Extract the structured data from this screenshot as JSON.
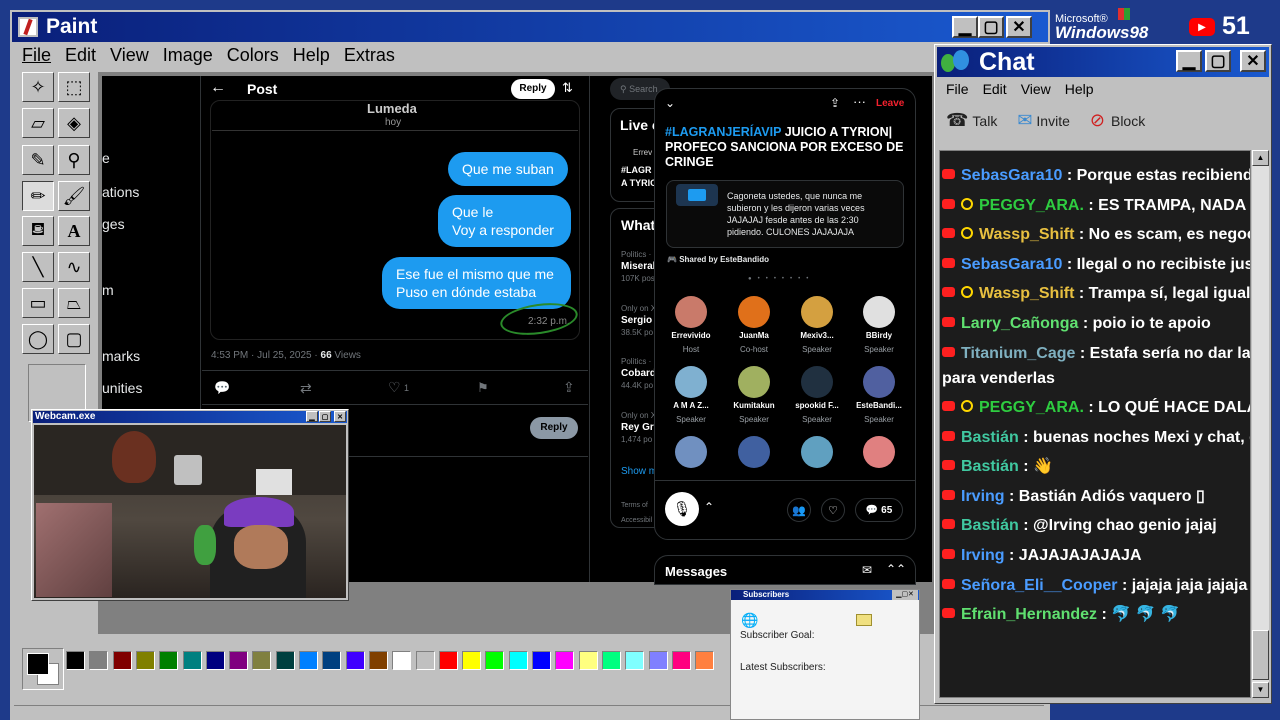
{
  "paint": {
    "title": "Paint",
    "menu": [
      "File",
      "Edit",
      "View",
      "Image",
      "Colors",
      "Help",
      "Extras"
    ],
    "palette": [
      "#000000",
      "#808080",
      "#800000",
      "#808000",
      "#008000",
      "#008080",
      "#000080",
      "#800080",
      "#808040",
      "#004040",
      "#0080ff",
      "#004080",
      "#4000ff",
      "#804000",
      "#ffffff",
      "#c0c0c0",
      "#ff0000",
      "#ffff00",
      "#00ff00",
      "#00ffff",
      "#0000ff",
      "#ff00ff",
      "#ffff80",
      "#00ff80",
      "#80ffff",
      "#8080ff",
      "#ff0080",
      "#ff8040"
    ]
  },
  "win98_logo": {
    "brand": "Microsoft®",
    "product": "Windows98"
  },
  "subs_count": "51",
  "twitter": {
    "header": "Post",
    "reply_button": "Reply",
    "top_name": "Lumeda",
    "top_sub": "hoy",
    "bubbles": [
      "Que me suban",
      "Que le\nVoy a responder",
      "Ese fue el mismo que me\nPuso en dónde estaba"
    ],
    "bubble_time": "2:32 p.m.",
    "meta_time": "4:53 PM · Jul 25, 2025 · ",
    "meta_views": "66",
    "meta_views_label": " Views",
    "likes": "1",
    "reply_box_button": "Reply",
    "left_nav": [
      "e",
      "ations",
      "ges",
      "m",
      "marks",
      "unities"
    ],
    "search_placeholder": "Search",
    "live_title": "Live o",
    "live_user": "Errev",
    "live_text1": "#LAGR",
    "live_text2": "A TYRIO",
    "whats": "What",
    "trends": [
      {
        "cat": "Politics · ",
        "title": "Miseral",
        "count": "107K posts"
      },
      {
        "cat": "Only on X",
        "title": "Sergio",
        "count": "38.5K po"
      },
      {
        "cat": "Politics ·",
        "title": "Cobard",
        "count": "44.4K po"
      },
      {
        "cat": "Only on X",
        "title": "Rey Gru",
        "count": "1,474 po"
      }
    ],
    "show_more": "Show m",
    "terms": "Terms of",
    "access": "Accessibil"
  },
  "space": {
    "leave": "Leave",
    "title_hashtag": "#LAGRANJERÍAVIP",
    "title_rest": " JUICIO A TYRION| PROFECO SANCIONA POR EXCESO DE CRINGE",
    "card_text": "Cagoneta ustedes, que nunca me subieron y les dijeron varias veces JAJAJAJ fesde antes de las 2:30 pidiendo. CULONES JAJAJAJA",
    "shared_by": "Shared by EsteBandido",
    "speakers": [
      {
        "name": "Errevivido",
        "role": "Host",
        "color": "#c97a6a"
      },
      {
        "name": "JuanMa",
        "role": "Co-host",
        "color": "#e0701a"
      },
      {
        "name": "Mexiv3...",
        "role": "Speaker",
        "color": "#d4a040"
      },
      {
        "name": "BBirdy",
        "role": "Speaker",
        "color": "#e0e0e0"
      },
      {
        "name": "A M A Z...",
        "role": "Speaker",
        "color": "#7fb0d0"
      },
      {
        "name": "Kumitakun",
        "role": "Speaker",
        "color": "#a0b060"
      },
      {
        "name": "spookid F...",
        "role": "Speaker",
        "color": "#203040"
      },
      {
        "name": "EsteBandi...",
        "role": "Speaker",
        "color": "#5060a0"
      },
      {
        "name": "",
        "role": "",
        "color": "#7090c0"
      },
      {
        "name": "",
        "role": "",
        "color": "#4060a0"
      },
      {
        "name": "",
        "role": "",
        "color": "#60a0c0"
      },
      {
        "name": "",
        "role": "",
        "color": "#e08080"
      }
    ],
    "reply_count": "65",
    "messages": "Messages"
  },
  "webcam": {
    "title": "Webcam.exe"
  },
  "subscribers": {
    "title": "Subscribers",
    "goal": "Subscriber Goal:",
    "latest": "Latest Subscribers:"
  },
  "chat": {
    "title": "Chat",
    "menu": [
      "File",
      "Edit",
      "View",
      "Help"
    ],
    "toolbar": [
      "Talk",
      "Invite",
      "Block"
    ],
    "messages": [
      {
        "user": "SebasGara10",
        "text": "Porque estas recibiendo lo q",
        "color": "#4a9cff",
        "mod": false
      },
      {
        "user": "PEGGY_ARA.",
        "text": "ES TRAMPA, NADA MÁS",
        "color": "#2ecc40",
        "mod": true
      },
      {
        "user": "Wassp_Shift",
        "text": "No es scam, es negocio",
        "color": "#e8c040",
        "mod": true
      },
      {
        "user": "SebasGara10",
        "text": "Ilegal o no recibiste justo lo q",
        "color": "#4a9cff",
        "mod": false
      },
      {
        "user": "Wassp_Shift",
        "text": "Trampa sí, legal igual y no,",
        "color": "#e8c040",
        "mod": true
      },
      {
        "user": "Larry_Cañongа",
        "text": "poio io te apoio",
        "color": "#60e070",
        "mod": false
      },
      {
        "user": "Titanium_Cage",
        "text": "Estafa sería no dar la cuent",
        "color": "#7fb0c0",
        "mod": false
      },
      {
        "user": "",
        "text": "para venderlas",
        "color": "#fff",
        "mod": false
      },
      {
        "user": "PEGGY_ARA.",
        "text": "LO QUÉ HACE DALASTIMA",
        "color": "#2ecc40",
        "mod": true
      },
      {
        "user": "Bastián",
        "text": "buenas noches Mexi y chat, que m",
        "color": "#40c8a0",
        "mod": false
      },
      {
        "user": "Bastián",
        "text": "👋",
        "color": "#40c8a0",
        "mod": false
      },
      {
        "user": "Irving",
        "text": "Bastián Adiós vaquero ▯",
        "color": "#4a9cff",
        "mod": false
      },
      {
        "user": "Bastián",
        "text": "@Irving chao genio jajaj",
        "color": "#40c8a0",
        "mod": false
      },
      {
        "user": "Irving",
        "text": "JAJAJAJAJAJA",
        "color": "#4a9cff",
        "mod": false
      },
      {
        "user": "Señora_Eli__Cooper",
        "text": "jajaja jaja jajaja",
        "color": "#4a9cff",
        "mod": false
      },
      {
        "user": "Efrain_Hernandez",
        "text": "🐬 🐬 🐬",
        "color": "#60e070",
        "mod": false
      }
    ]
  }
}
